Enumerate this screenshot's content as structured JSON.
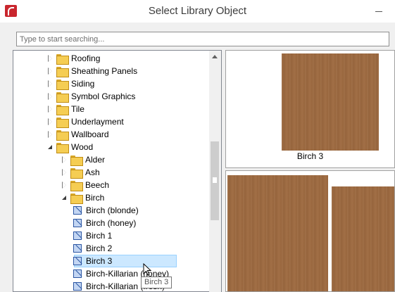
{
  "window": {
    "title": "Select Library Object"
  },
  "search": {
    "placeholder": "Type to start searching..."
  },
  "tree": {
    "items": [
      {
        "label": "Roofing",
        "kind": "folder",
        "state": "closed",
        "level": 1
      },
      {
        "label": "Sheathing Panels",
        "kind": "folder",
        "state": "closed",
        "level": 1
      },
      {
        "label": "Siding",
        "kind": "folder",
        "state": "closed",
        "level": 1
      },
      {
        "label": "Symbol Graphics",
        "kind": "folder",
        "state": "closed",
        "level": 1
      },
      {
        "label": "Tile",
        "kind": "folder",
        "state": "closed",
        "level": 1
      },
      {
        "label": "Underlayment",
        "kind": "folder",
        "state": "closed",
        "level": 1
      },
      {
        "label": "Wallboard",
        "kind": "folder",
        "state": "closed",
        "level": 1
      },
      {
        "label": "Wood",
        "kind": "folder",
        "state": "open",
        "level": 1
      },
      {
        "label": "Alder",
        "kind": "folder",
        "state": "closed",
        "level": 2
      },
      {
        "label": "Ash",
        "kind": "folder",
        "state": "closed",
        "level": 2
      },
      {
        "label": "Beech",
        "kind": "folder",
        "state": "closed",
        "level": 2
      },
      {
        "label": "Birch",
        "kind": "folder",
        "state": "open",
        "level": 2
      },
      {
        "label": "Birch (blonde)",
        "kind": "material",
        "level": 3
      },
      {
        "label": "Birch (honey)",
        "kind": "material",
        "level": 3
      },
      {
        "label": "Birch 1",
        "kind": "material",
        "level": 3
      },
      {
        "label": "Birch 2",
        "kind": "material",
        "level": 3
      },
      {
        "label": "Birch 3",
        "kind": "material",
        "level": 3,
        "selected": true
      },
      {
        "label": "Birch-Killarian (honey)",
        "kind": "material",
        "level": 3
      },
      {
        "label": "Birch-Killarian (fresh)",
        "kind": "material",
        "level": 3
      }
    ]
  },
  "preview": {
    "caption": "Birch 3",
    "wood_color": "#9e6a40"
  },
  "tooltip": {
    "text": "Birch 3"
  },
  "colors": {
    "selection": "#cce8ff",
    "selection_border": "#99d1ff",
    "folder": "#f5cd53"
  }
}
